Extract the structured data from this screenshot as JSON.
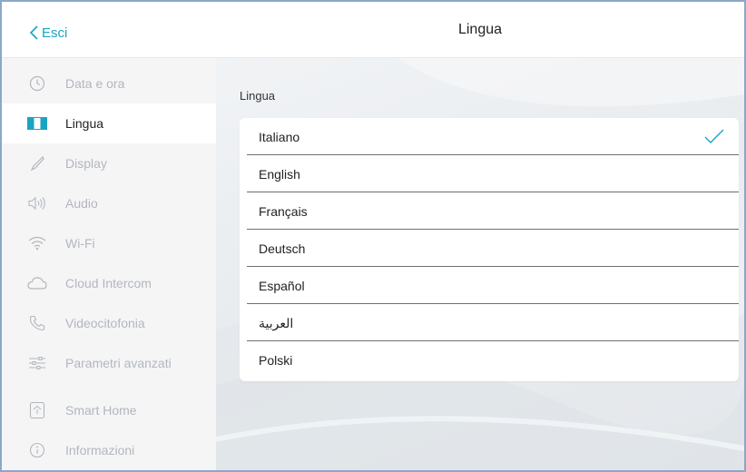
{
  "header": {
    "back_label": "Esci",
    "title": "Lingua"
  },
  "sidebar": {
    "items": [
      {
        "label": "Data e ora",
        "icon": "clock-icon",
        "active": false
      },
      {
        "label": "Lingua",
        "icon": "language-icon",
        "active": true
      },
      {
        "label": "Display",
        "icon": "brush-icon",
        "active": false
      },
      {
        "label": "Audio",
        "icon": "speaker-icon",
        "active": false
      },
      {
        "label": "Wi-Fi",
        "icon": "wifi-icon",
        "active": false
      },
      {
        "label": "Cloud Intercom",
        "icon": "cloud-icon",
        "active": false
      },
      {
        "label": "Videocitofonia",
        "icon": "phone-icon",
        "active": false
      },
      {
        "label": "Parametri avanzati",
        "icon": "sliders-icon",
        "active": false
      },
      {
        "label": "Smart Home",
        "icon": "smart-home-icon",
        "active": false
      },
      {
        "label": "Informazioni",
        "icon": "info-icon",
        "active": false
      }
    ]
  },
  "main": {
    "section_label": "Lingua",
    "languages": [
      {
        "name": "Italiano",
        "selected": true
      },
      {
        "name": "English",
        "selected": false
      },
      {
        "name": "Français",
        "selected": false
      },
      {
        "name": "Deutsch",
        "selected": false
      },
      {
        "name": "Español",
        "selected": false
      },
      {
        "name": "العربية",
        "selected": false
      },
      {
        "name": "Polski",
        "selected": false
      }
    ]
  },
  "colors": {
    "accent": "#1aa3c4",
    "sidebar_bg": "#f5f5f6",
    "inactive_text": "#b2b7bd",
    "active_text": "#222222"
  }
}
